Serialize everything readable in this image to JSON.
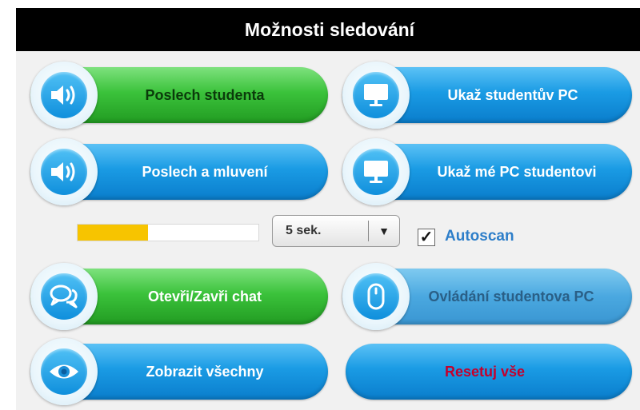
{
  "title": "Možnosti sledování",
  "buttons": {
    "listen_student": "Poslech studenta",
    "show_student_pc": "Ukaž studentův PC",
    "listen_and_talk": "Poslech a mluvení",
    "show_my_pc": "Ukaž mé PC studentovi",
    "open_close_chat": "Otevři/Zavři chat",
    "control_student_pc": "Ovládání studentova PC",
    "show_all": "Zobrazit všechny",
    "reset_all": "Resetuj vše"
  },
  "scan": {
    "progress": 0.39,
    "interval_value": "5 sek.",
    "autoscan_label": "Autoscan",
    "autoscan_checked": true
  },
  "colors": {
    "header_bg": "#000000",
    "blue_button": "#1a9be4",
    "green_button": "#3bc23b",
    "reset_text": "#c4002c",
    "progress_fill": "#f7c400",
    "autoscan_text": "#2d7ec9"
  },
  "icons": {
    "listen_student": "speaker-icon",
    "listen_and_talk": "speaker-icon",
    "show_student_pc": "monitor-icon",
    "show_my_pc": "monitor-icon",
    "chat": "chat-bubbles-icon",
    "control": "mouse-icon",
    "show_all": "eye-icon"
  }
}
